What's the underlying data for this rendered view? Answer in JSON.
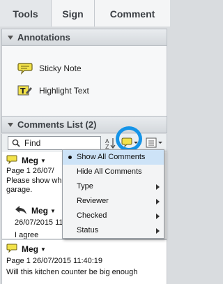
{
  "tabs": [
    {
      "label": "Tools"
    },
    {
      "label": "Sign"
    },
    {
      "label": "Comment"
    }
  ],
  "annotations_panel": {
    "title": "Annotations",
    "tools": [
      {
        "label": "Sticky Note",
        "icon": "sticky-note-icon"
      },
      {
        "label": "Highlight Text",
        "icon": "highlight-text-icon"
      }
    ]
  },
  "comments_panel": {
    "title": "Comments List (2)",
    "search": {
      "value": "Find"
    },
    "comments": [
      {
        "author": "Meg",
        "meta": "Page 1  26/07/",
        "text": "Please show whe",
        "text2": "garage.",
        "reply": {
          "author": "Meg",
          "meta": "26/07/2015 11",
          "text": "I agree"
        }
      },
      {
        "author": "Meg",
        "meta": "Page 1  26/07/2015 11:40:19",
        "text": "Will this kitchen counter be big enough"
      }
    ]
  },
  "menu": {
    "items": [
      {
        "label": "Show All Comments",
        "checked": true,
        "submenu": false
      },
      {
        "label": "Hide All Comments",
        "checked": false,
        "submenu": false
      },
      {
        "label": "Type",
        "checked": false,
        "submenu": true
      },
      {
        "label": "Reviewer",
        "checked": false,
        "submenu": true
      },
      {
        "label": "Checked",
        "checked": false,
        "submenu": true
      },
      {
        "label": "Status",
        "checked": false,
        "submenu": true
      }
    ]
  },
  "colors": {
    "accent_ring": "#1594e8",
    "note_yellow": "#f2e24a",
    "menu_highlight": "#cde3f7"
  }
}
